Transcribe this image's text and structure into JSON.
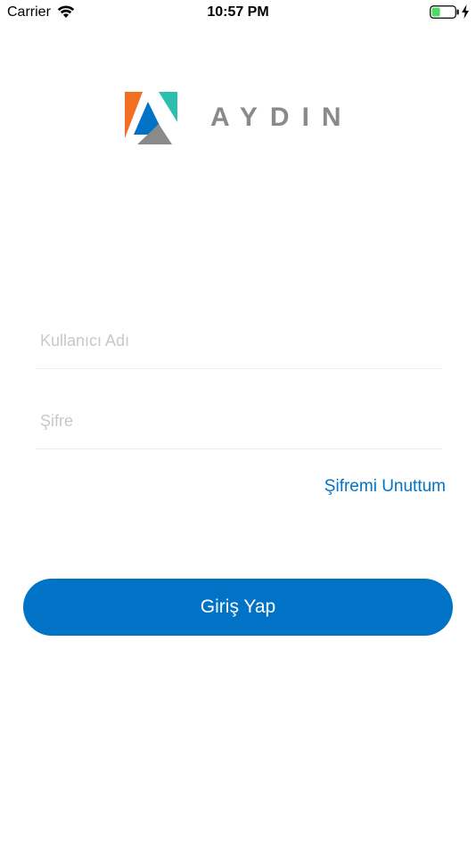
{
  "status_bar": {
    "carrier": "Carrier",
    "time": "10:57 PM",
    "wifi_icon": "wifi-icon",
    "battery_icon": "battery-icon",
    "charging_icon": "charging-bolt-icon"
  },
  "logo": {
    "mark_icon": "aydin-logo-mark",
    "name": "AYDIN",
    "colors": {
      "orange": "#f36f21",
      "teal": "#2bbfb0",
      "blue": "#0073c6",
      "gray": "#8a8a8a"
    }
  },
  "login_form": {
    "username_placeholder": "Kullanıcı Adı",
    "username_value": "",
    "password_placeholder": "Şifre",
    "password_value": "",
    "forgot_password_label": "Şifremi Unuttum",
    "submit_label": "Giriş Yap"
  },
  "theme": {
    "accent": "#0073c6",
    "placeholder": "#c8c8c8",
    "divider": "#eeeeee"
  }
}
